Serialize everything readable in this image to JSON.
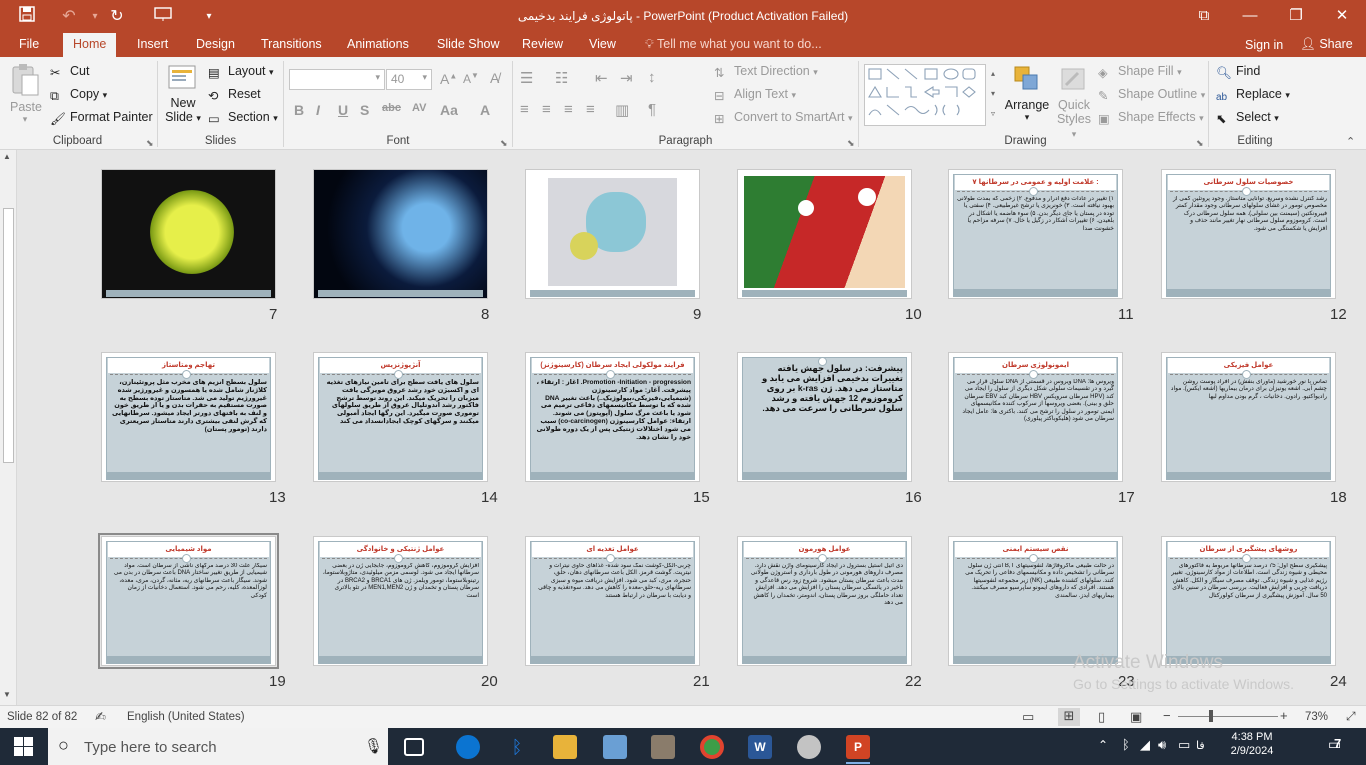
{
  "window": {
    "title": "پاتولوژی فرایند بدخیمی - PowerPoint (Product Activation Failed)"
  },
  "tabs": [
    "File",
    "Home",
    "Insert",
    "Design",
    "Transitions",
    "Animations",
    "Slide Show",
    "Review",
    "View"
  ],
  "tell_me": "Tell me what you want to do...",
  "account": {
    "signin": "Sign in",
    "share": "Share"
  },
  "ribbon": {
    "clipboard": {
      "label": "Clipboard",
      "paste": "Paste",
      "cut": "Cut",
      "copy": "Copy",
      "format_painter": "Format Painter"
    },
    "slides": {
      "label": "Slides",
      "new_slide_1": "New",
      "new_slide_2": "Slide",
      "layout": "Layout",
      "reset": "Reset",
      "section": "Section"
    },
    "font": {
      "label": "Font",
      "size": "40"
    },
    "paragraph": {
      "label": "Paragraph",
      "text_direction": "Text Direction",
      "align_text": "Align Text",
      "smartart": "Convert to SmartArt"
    },
    "drawing": {
      "label": "Drawing",
      "arrange": "Arrange",
      "quick_styles_1": "Quick",
      "quick_styles_2": "Styles",
      "shape_fill": "Shape Fill",
      "shape_outline": "Shape Outline",
      "shape_effects": "Shape Effects"
    },
    "editing": {
      "label": "Editing",
      "find": "Find",
      "replace": "Replace",
      "select": "Select"
    }
  },
  "slides": [
    {
      "num": "12",
      "title": "خصوصیات سلول سرطانی",
      "body": "رشد کنترل نشده وسریع. توانایی متاستاز. وجود پروتئین کمی از مخصوص تومور در غشای سلولهای سرطانی وجود مقدار کمتر فیبرونکتین (سیمنت بین سلولی). همه سلول سرطانی درک است. کروموزوم سلول سرطانی نهار تغییر مانند حذف و افزایش یا شکستگی می شود.",
      "type": "text"
    },
    {
      "num": "11",
      "title": "۷ علامت اولیه و عمومی در سرطانها :",
      "body": "۱) تغییر در عادات دفع ادرار و مدفوع. ۲) زخمی که بمدت طولانی بهبود نیافته است. ۳) خونریزی یا ترشح غیرطبیعی. ۴) سفتی یا توده در پستان یا جای دیگر بدن. ۵) سوء هاضمه یا اشکال در بلعیدن. ۶) تغییرات آشکار در زگیل یا خال. ۷) سرفه مزاحم یا خشونت صدا",
      "type": "text"
    },
    {
      "num": "10",
      "title": "",
      "body": "",
      "type": "img-red"
    },
    {
      "num": "9",
      "title": "",
      "body": "",
      "type": "img-cell"
    },
    {
      "num": "8",
      "title": "",
      "body": "",
      "type": "img-dark"
    },
    {
      "num": "7",
      "title": "",
      "body": "",
      "type": "img-yellow"
    },
    {
      "num": "18",
      "title": "عوامل فیزیکی",
      "body": "تماس با نور خورشید (ماورای بنفش) در افراد پوست روشن چشم آبی. اشعه یونیزان برای درمان بیماریها (اشعه ایکس). مواد رادیواکتیو. رادون. دخانیات ، گرم بودن مداوم لبها",
      "type": "text"
    },
    {
      "num": "17",
      "title": "ایمونولوژی سرطان",
      "body": "ویروس ها: DNA ویروس در قسمتی از DNA سلول قرار می گیرد و در تقسیمات سلولی شکل دیگری از سلول را ایجاد می کند (HPV سرطان سرویکس HBV سرطان کبد EBV سرطان حلق و بینی). بعضی ویروسها از سرکوب کننده مکانیسمهای ایمنی تومور در سلول را ترشح می کنند. باکتری ها: عامل ایجاد سرطان می شود (هلیکوباکتر پیلوری)",
      "type": "text"
    },
    {
      "num": "16",
      "title": "",
      "body": "پیشرفت: در سلول جهش یافته تغییرات بدخیمی افزایش می یابد و متاستاز می دهد. ژن k-ras بر روی کروموزوم 12 جهش یافته و رشد سلول سرطانی را سرعت می دهد.",
      "type": "text-big"
    },
    {
      "num": "15",
      "title": "فرایند مولکولی ایجاد سرطان (کارسینوژنز)",
      "body": "Promotion -Initiation - progression. آغاز : ارتقاء ، پیشرفت. آغاز: مواد کارسینوژن (شیمیایی،فیزیکی،بیولوژیک..) باعث تغییر DNA شده که با توسط مکانیسمهای دفاعی ترمیم می شود یا باعث مرگ سلول (آپوپتوز) می شوند. ارتقاء: عوامل کارسینوژن (co-carcinogen) سبب می شود اختلالات ژنتیکی پس از یک دوره طولانی خود را نشان دهد.",
      "type": "text-bold"
    },
    {
      "num": "14",
      "title": "آنژیوژنزیس",
      "body": "سلول های یافت سطح برای تامین نیازهای تغذیه ای و اکسیژن خود رشد عروق مویرگی یافت میزبان را تحریک میکند. این روند توسط ترشح فاکتور رشد اندوتلیال عروق از طریق سلولهای توموری صورت میگیرد. این رگها ایجاد آمبولی میکنند و سرگهای کوچک ایجادانسداد می کند",
      "type": "text-bold"
    },
    {
      "num": "13",
      "title": "تهاجم ومتاستاز",
      "body": "سلول بسطح آنزیم های مخرب مثل پروتئینازن، کلاژناز شامل شده یا همسوزن و غیرورژیر شده غیرورژیم تولید می شد. متاستاز توده بسطح به صورت مستقیم به حفرات بدن و یا از طریق خون و لنف به بافتهای دورتر ایجاد میشود. سرطانهایی که گرش لنفی بیشتری دارند متاستاز سریعتری دارند (تومور پستان)",
      "type": "text-bold"
    },
    {
      "num": "24",
      "title": "روشهای پیشگیری از سرطان",
      "body": "پیشگیری سطح اول: 75 درصد سرطانها مربوط به فاکتورهای محیطی و شیوه زندگی است. اطلاعات از مواد کارسینوژن. تغییر رژیم غذایی و شیوه زندگی. توقف مصرف سیگار و الکل. کاهش دریافت چربی و افزایش فعالیت. بررسی سرطان در سنین بالای 50 سال. آموزش پیشگیری از سرطان کولورکتال",
      "type": "text"
    },
    {
      "num": "23",
      "title": "نقص سیستم ایمنی",
      "body": "در حالت طبیعی ماکروفاژها، لنفوسیتهای B,T آنتی ژن سلول سرطانی را تشخیص داده و مکانیسمهای دفاعی را تحریک می کنند. سلولهای کشنده طبیعی (NK) زیر مجموعه لنفوسیتها هستند. افرادی که داروهای ایمونو ساپرسیو مصرف میکنند. بیماریهای ایدز. سالمندی",
      "type": "text"
    },
    {
      "num": "22",
      "title": "عوامل هورمون",
      "body": "دی اتیل استیل بسترول در ایجاد کارسینومای واژن نقش دارد. مصرف داروهای هورمونی در طول بارداری و استروژن طولانی مدت باعث سرطان پستان میشود. شروع زود رس قاعدگی و تاخیر در یائسگی سرطان پستان را افزایش می دهد. افزایش تعداد حاملگی بروز سرطان پستان، اندومتر، تخمدان را کاهش می دهد",
      "type": "text"
    },
    {
      "num": "21",
      "title": "عوامل تغذیه ای",
      "body": "چربی-الکل-گوشت نمک سود شده- غذاهای حاوی نیترات و نیتریت. گوشت قرمز. الکل باعث سرطانهای دهان، حلق، حنجره، مری، کبد می شود. افزایش دریافت میوه و سبزی سرطانهای ریه-حلق-معده را کاهش می دهد. سوءتغذیه و چاقی و دیابت با سرطان در ارتباط هستند",
      "type": "text"
    },
    {
      "num": "20",
      "title": "عوامل ژنتیکی و خانوادگی",
      "body": "افزایش کروموزوم، کاهش کروموزوم، جابجایی ژن در بعضی سرطانها ایجاد می شود. لوسمی مزمن میلوئیدی، متاژوبلاستوما، رتینوبلاستوما، تومور ویلمز. ژن های BRCA1 و BRCA2 در سرطان پستان و تخمدان و ژن MEN1,MEN2 در تئو بالاتری است",
      "type": "text"
    },
    {
      "num": "19",
      "title": "مواد شیمیایی",
      "body": "سیگار علت 30 درصد مرگهای ناشی از سرطان است. مواد شیمیایی از طریق تغییر ساختار DNA باعث سرطان در بدن می شوند. سیگار باعث سرطانهای ریه، مثانه، گردن، مری، معده، لوزالمعده، کلیه، رحم می شود. استعمال دخانیات از زمان کودکی",
      "type": "text"
    }
  ],
  "watermark": {
    "line1": "Activate Windows",
    "line2": "Go to Settings to activate Windows."
  },
  "status": {
    "slide": "Slide 82 of 82",
    "language": "English (United States)",
    "zoom": "73%"
  },
  "taskbar": {
    "search": "Type here to search",
    "time": "4:38 PM",
    "date": "2/9/2024",
    "lang": "فا",
    "notifications": "7"
  }
}
